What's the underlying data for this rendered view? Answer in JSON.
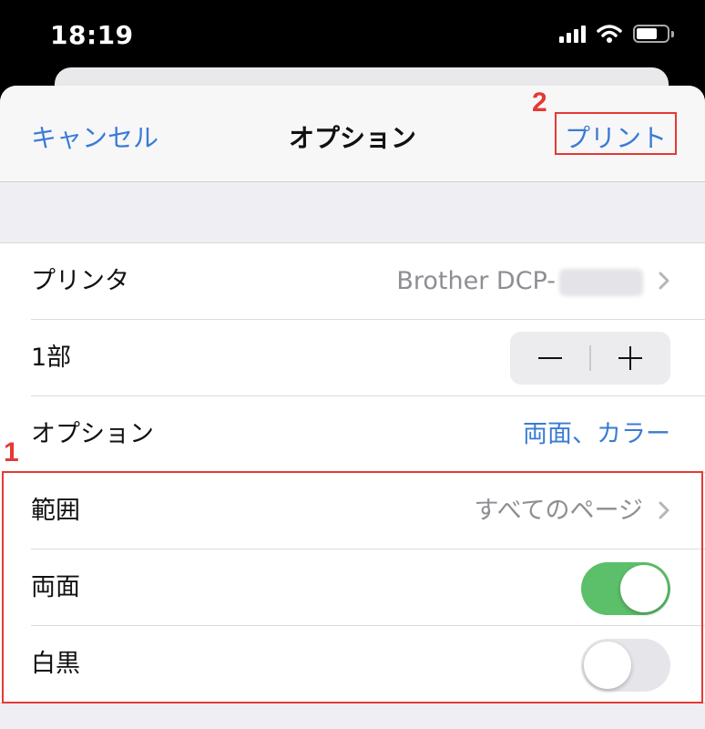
{
  "status_bar": {
    "time": "18:19"
  },
  "nav": {
    "cancel": "キャンセル",
    "title": "オプション",
    "print": "プリント"
  },
  "markers": {
    "range_section": "1",
    "print_button": "2"
  },
  "rows": [
    {
      "label": "プリンタ",
      "value": "Brother DCP-"
    },
    {
      "label": "1部"
    },
    {
      "label": "オプション",
      "value": "両面、カラー"
    },
    {
      "label": "範囲",
      "value": "すべてのページ"
    },
    {
      "label": "両面",
      "toggle_on": true
    },
    {
      "label": "白黒",
      "toggle_on": false
    }
  ],
  "colors": {
    "accent": "#3a7bd5",
    "toggle_on": "#5cbf6a",
    "highlight": "#e53935"
  }
}
